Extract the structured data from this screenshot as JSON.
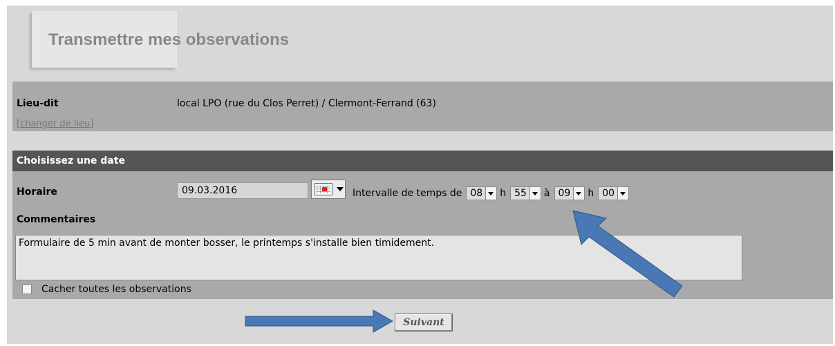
{
  "header": {
    "title": "Transmettre mes observations"
  },
  "location": {
    "label": "Lieu-dit",
    "value": "local LPO (rue du Clos Perret) / Clermont-Ferrand (63)",
    "change_link": "[changer de lieu]"
  },
  "date_section": {
    "header": "Choisissez une date",
    "horaire_label": "Horaire",
    "date_value": "09.03.2016",
    "interval_label": "Intervalle de temps de",
    "start_hour": "08",
    "h_sep": "h",
    "start_minute": "55",
    "to_label": "à",
    "end_hour": "09",
    "end_minute": "00"
  },
  "comments": {
    "label": "Commentaires",
    "value": "Formulaire de 5 min avant de monter bosser, le printemps s'installe bien timidement."
  },
  "hide_observations": {
    "label": "Cacher toutes les observations",
    "checked": false
  },
  "next_button": {
    "label": "Suivant"
  },
  "colors": {
    "panel": "#a9a9a9",
    "header_bar": "#555555",
    "annotation_arrow": "#4a78b4"
  },
  "icons": [
    "calendar-icon",
    "dropdown-arrow-icon",
    "annotation-arrow-icon"
  ]
}
